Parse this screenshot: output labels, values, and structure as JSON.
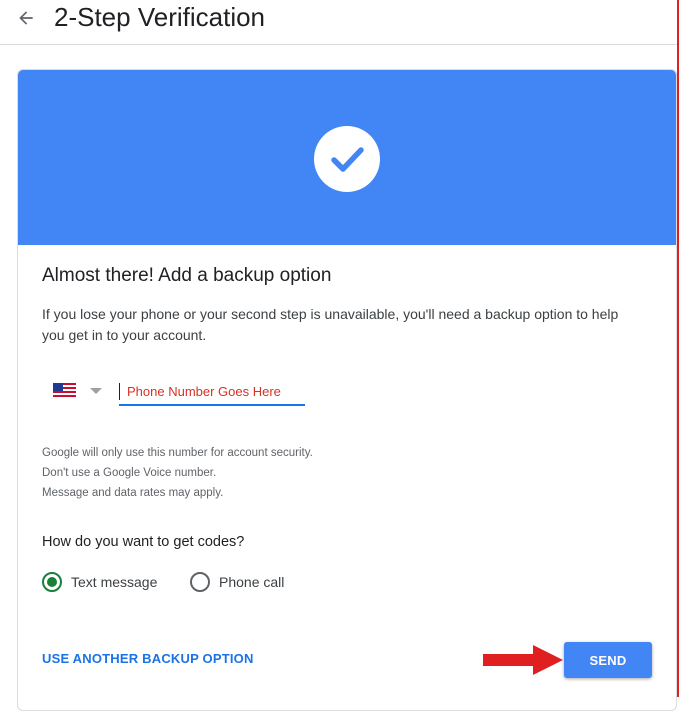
{
  "header": {
    "title": "2-Step Verification",
    "back_icon": "arrow-left-icon"
  },
  "banner": {
    "color": "#4285f4",
    "icon": "check-circle-icon"
  },
  "card": {
    "title": "Almost there! Add a backup option",
    "description": "If you lose your phone or your second step is unavailable, you'll need a backup option to help you get in to your account."
  },
  "phone": {
    "country_icon": "us-flag-icon",
    "value": "Phone Number Goes Here"
  },
  "notes": [
    "Google will only use this number for account security.",
    "Don't use a Google Voice number.",
    "Message and data rates may apply."
  ],
  "codes": {
    "question": "How do you want to get codes?",
    "options": [
      {
        "label": "Text message",
        "selected": true
      },
      {
        "label": "Phone call",
        "selected": false
      }
    ]
  },
  "actions": {
    "other_option": "USE ANOTHER BACKUP OPTION",
    "send": "SEND"
  },
  "colors": {
    "accent": "#4285f4",
    "link": "#1a73e8",
    "radio_selected": "#188038",
    "annotation": "#e02020"
  }
}
